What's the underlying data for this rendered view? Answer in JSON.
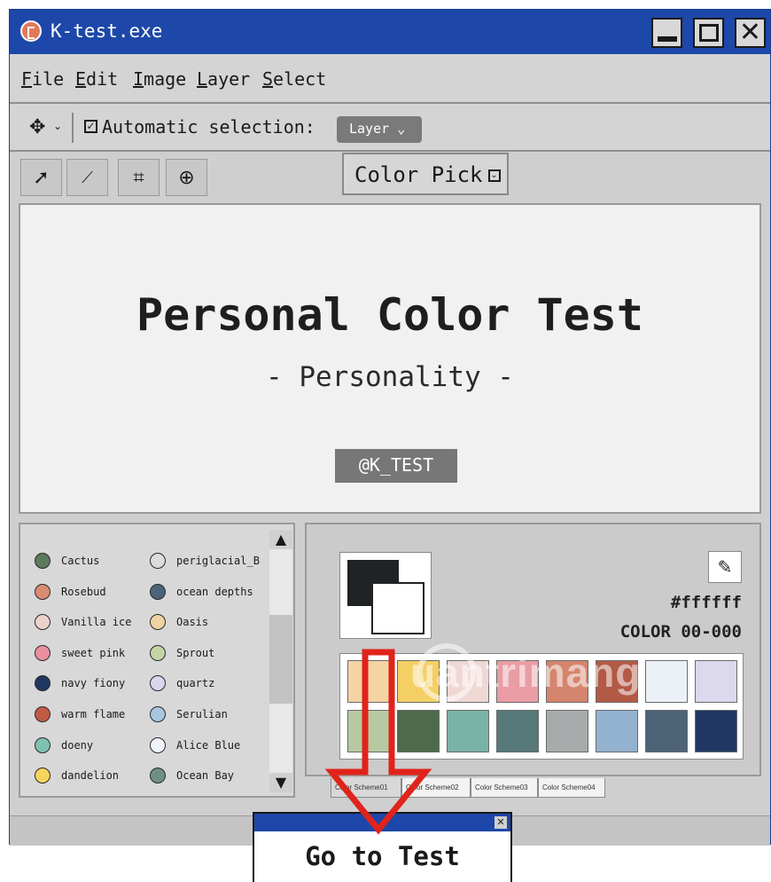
{
  "window": {
    "title": "K-test.exe"
  },
  "menu": {
    "items": [
      "File",
      "Edit",
      "Image",
      "Layer",
      "Select"
    ]
  },
  "options": {
    "auto_selection_label": "Automatic selection:",
    "layer_dropdown": "Layer ⌄",
    "move_chevron": "⌄"
  },
  "tools": {
    "color_pick_label": "Color Pick"
  },
  "canvas": {
    "title": "Personal Color Test",
    "subtitle": "- Personality -",
    "handle": "@K_TEST"
  },
  "color_list": [
    {
      "name": "Cactus",
      "color": "#5c7a5c"
    },
    {
      "name": "periglacial_B",
      "color": "#dcdcdc"
    },
    {
      "name": "Rosebud",
      "color": "#d98b73"
    },
    {
      "name": "ocean depths",
      "color": "#4d6478"
    },
    {
      "name": "Vanilla ice",
      "color": "#ebd3cc"
    },
    {
      "name": "Oasis",
      "color": "#f0d3a2"
    },
    {
      "name": "sweet pink",
      "color": "#e98f9f"
    },
    {
      "name": "Sprout",
      "color": "#c5d6a6"
    },
    {
      "name": "navy fiony",
      "color": "#1f3760"
    },
    {
      "name": "quartz",
      "color": "#d9d6ee"
    },
    {
      "name": "warm flame",
      "color": "#c25a44"
    },
    {
      "name": "Serulian",
      "color": "#a8c5e1"
    },
    {
      "name": "doeny",
      "color": "#7fc1b0"
    },
    {
      "name": "Alice Blue",
      "color": "#f0f5fc"
    },
    {
      "name": "dandelion",
      "color": "#f7d55c"
    },
    {
      "name": "Ocean Bay",
      "color": "#6f8f86"
    }
  ],
  "color_panel": {
    "hex_value": "#ffffff",
    "color_code": "COLOR 00-000",
    "fg_color": "#1f2323",
    "bg_color": "#ffffff",
    "palette_row1": [
      "#f4d3a5",
      "#f4cf64",
      "#efd8d4",
      "#e99ca4",
      "#d5846e",
      "#b25a46",
      "#ecf1f8",
      "#dcd8ed"
    ],
    "palette_row2": [
      "#b7c9a1",
      "#4d6b4a",
      "#79b2a6",
      "#577879",
      "#a7abab",
      "#93b2d0",
      "#4d6378",
      "#1f3762"
    ]
  },
  "tabs": [
    "Color Scheme01",
    "Color Scheme02",
    "Color Scheme03",
    "Color Scheme04"
  ],
  "watermark": "uantrimang",
  "dialog": {
    "label": "Go to Test",
    "close_glyph": "✕"
  },
  "colors": {
    "titlebar": "#1d47a8",
    "arrow": "#e0231b"
  }
}
